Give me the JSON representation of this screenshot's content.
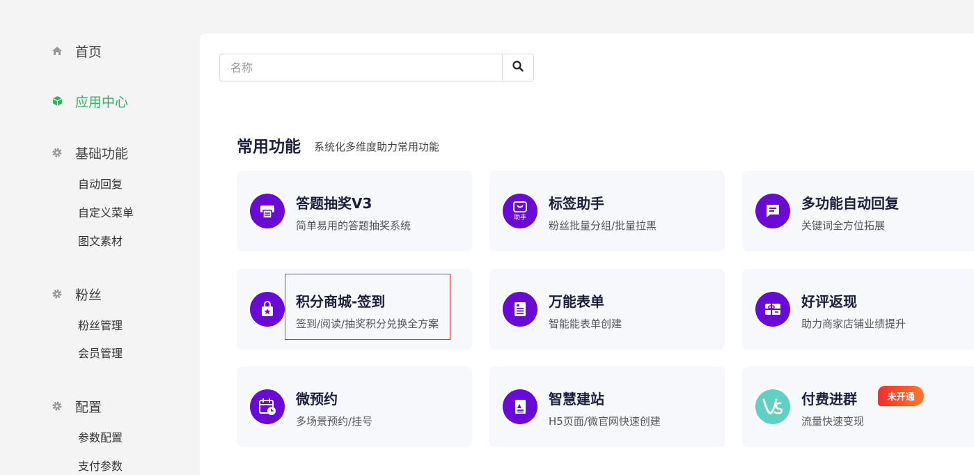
{
  "sidebar": {
    "home": "首页",
    "app_center": "应用中心",
    "basic": {
      "label": "基础功能",
      "items": [
        "自动回复",
        "自定义菜单",
        "图文素材"
      ]
    },
    "fans": {
      "label": "粉丝",
      "items": [
        "粉丝管理",
        "会员管理"
      ]
    },
    "config": {
      "label": "配置",
      "items": [
        "参数配置",
        "支付参数"
      ]
    }
  },
  "search": {
    "placeholder": "名称",
    "value": ""
  },
  "section": {
    "title": "常用功能",
    "subtitle": "系统化多维度助力常用功能"
  },
  "apps": [
    {
      "name": "答题抽奖V3",
      "desc": "简单易用的答题抽奖系统",
      "icon": "printer-icon"
    },
    {
      "name": "标签助手",
      "desc": "粉丝批量分组/批量拉黑",
      "icon": "bag-icon",
      "icon_text": "助手"
    },
    {
      "name": "多功能自动回复",
      "desc": "关键词全方位拓展",
      "icon": "chat-icon"
    },
    {
      "name": "积分商城-签到",
      "desc": "签到/阅读/抽奖积分兑换全方案",
      "icon": "shopping-bag-star-icon"
    },
    {
      "name": "万能表单",
      "desc": "智能能表单创建",
      "icon": "form-icon"
    },
    {
      "name": "好评返现",
      "desc": "助力商家店铺业绩提升",
      "icon": "gift-card-icon"
    },
    {
      "name": "微预约",
      "desc": "多场景预约/挂号",
      "icon": "calendar-clock-icon"
    },
    {
      "name": "智慧建站",
      "desc": "H5页面/微官网快速创建",
      "icon": "page-icon"
    },
    {
      "name": "付费进群",
      "desc": "流量快速变现",
      "icon": "vs-logo-icon",
      "badge": "未开通"
    }
  ],
  "colors": {
    "accent": "#2bb55c",
    "icon_purple": "#6a0ad8",
    "icon_teal": "#5fd1c2",
    "badge": "#ff4a2a",
    "highlight_box": "#e03030"
  }
}
